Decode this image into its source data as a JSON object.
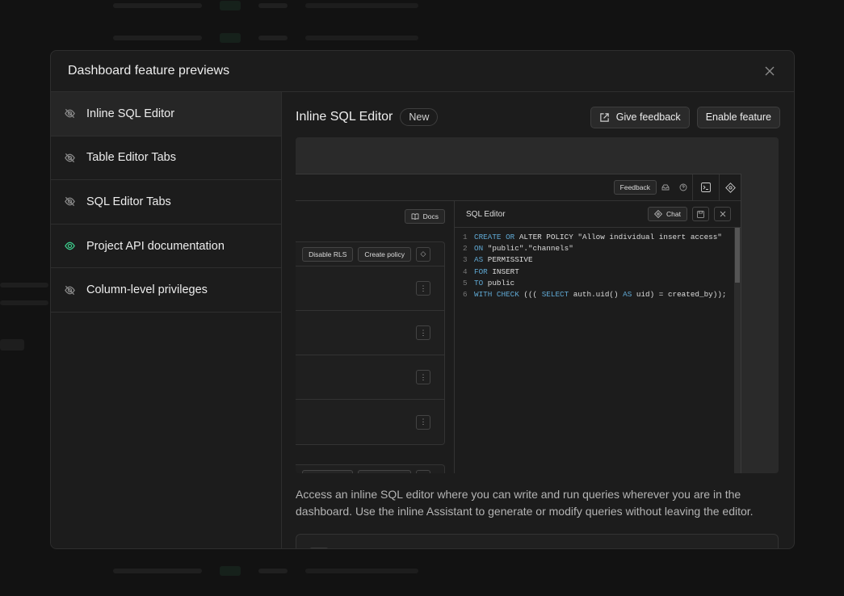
{
  "modal": {
    "title": "Dashboard feature previews"
  },
  "sidebar": {
    "items": [
      {
        "label": "Inline SQL Editor",
        "icon": "eye-off-icon",
        "active": true
      },
      {
        "label": "Table Editor Tabs",
        "icon": "eye-off-icon",
        "active": false
      },
      {
        "label": "SQL Editor Tabs",
        "icon": "eye-off-icon",
        "active": false
      },
      {
        "label": "Project API documentation",
        "icon": "eye-icon",
        "active": false
      },
      {
        "label": "Column-level privileges",
        "icon": "eye-off-icon",
        "active": false
      }
    ]
  },
  "feature": {
    "title": "Inline SQL Editor",
    "badge": "New",
    "feedback_label": "Give feedback",
    "enable_label": "Enable feature",
    "description": "Access an inline SQL editor where you can write and run queries wherever you are in the dashboard. Use the inline Assistant to generate or modify queries without leaving the editor."
  },
  "preview": {
    "feedback_label": "Feedback",
    "docs_label": "Docs",
    "disable_rls_label": "Disable RLS",
    "create_policy_label": "Create policy",
    "editor_title": "SQL Editor",
    "chat_label": "Chat",
    "code_lines": [
      {
        "n": "1",
        "parts": [
          [
            "kw",
            "CREATE"
          ],
          [
            "tx",
            " "
          ],
          [
            "kw",
            "OR"
          ],
          [
            "tx",
            " ALTER POLICY "
          ],
          [
            "str",
            "\"Allow individual insert access\""
          ]
        ]
      },
      {
        "n": "2",
        "parts": [
          [
            "kw",
            "ON"
          ],
          [
            "tx",
            " "
          ],
          [
            "str",
            "\"public\".\"channels\""
          ]
        ]
      },
      {
        "n": "3",
        "parts": [
          [
            "kw",
            "AS"
          ],
          [
            "tx",
            " PERMISSIVE"
          ]
        ]
      },
      {
        "n": "4",
        "parts": [
          [
            "kw",
            "FOR"
          ],
          [
            "tx",
            " INSERT"
          ]
        ]
      },
      {
        "n": "5",
        "parts": [
          [
            "kw",
            "TO"
          ],
          [
            "tx",
            " public"
          ]
        ]
      },
      {
        "n": "6",
        "parts": [
          [
            "kw",
            "WITH CHECK"
          ],
          [
            "tx",
            " ((( "
          ],
          [
            "kw",
            "SELECT"
          ],
          [
            "tx",
            " auth.uid() "
          ],
          [
            "kw",
            "AS"
          ],
          [
            "tx",
            " uid) = created_by));"
          ]
        ]
      }
    ]
  },
  "colors": {
    "accent_green": "#3ecf8e",
    "keyword_blue": "#5fa8d3"
  }
}
